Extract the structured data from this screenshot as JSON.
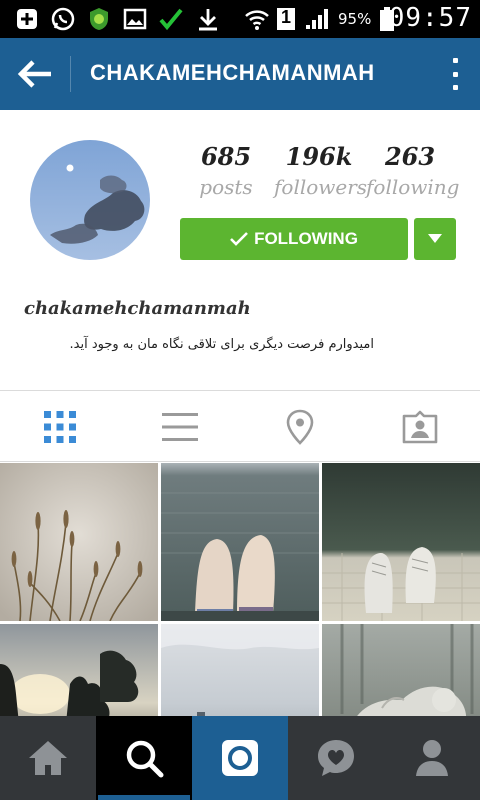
{
  "status_bar": {
    "time": "09:57",
    "battery_percent": "95%",
    "network_badge": "1"
  },
  "app_bar": {
    "title": "CHAKAMEHCHAMANMAH"
  },
  "profile": {
    "stats": [
      {
        "value": "685",
        "label": "posts"
      },
      {
        "value": "196k",
        "label": "followers"
      },
      {
        "value": "263",
        "label": "following"
      }
    ],
    "follow_button_label": "FOLLOWING",
    "username": "chakamehchamanmah",
    "bio": "امیدوارم فرصت دیگری برای تلاقی نگاه مان به وجود آید."
  },
  "tabs": [
    {
      "icon": "grid-icon",
      "active": true
    },
    {
      "icon": "list-icon",
      "active": false
    },
    {
      "icon": "location-pin-icon",
      "active": false
    },
    {
      "icon": "tagged-user-icon",
      "active": false
    }
  ],
  "bottom_nav": [
    {
      "icon": "home-icon",
      "active": false
    },
    {
      "icon": "search-icon",
      "active": true
    },
    {
      "icon": "camera-icon",
      "active": false
    },
    {
      "icon": "activity-heart-icon",
      "active": false
    },
    {
      "icon": "profile-icon",
      "active": false
    }
  ],
  "colors": {
    "app_bar": "#1d5f93",
    "follow_green": "#5cb530",
    "tab_active": "#3b8bd6",
    "tab_inactive": "#9a9a9a",
    "nav_bg": "#333639",
    "nav_search_bg": "#000000",
    "nav_camera_bg": "#1d5f93"
  }
}
